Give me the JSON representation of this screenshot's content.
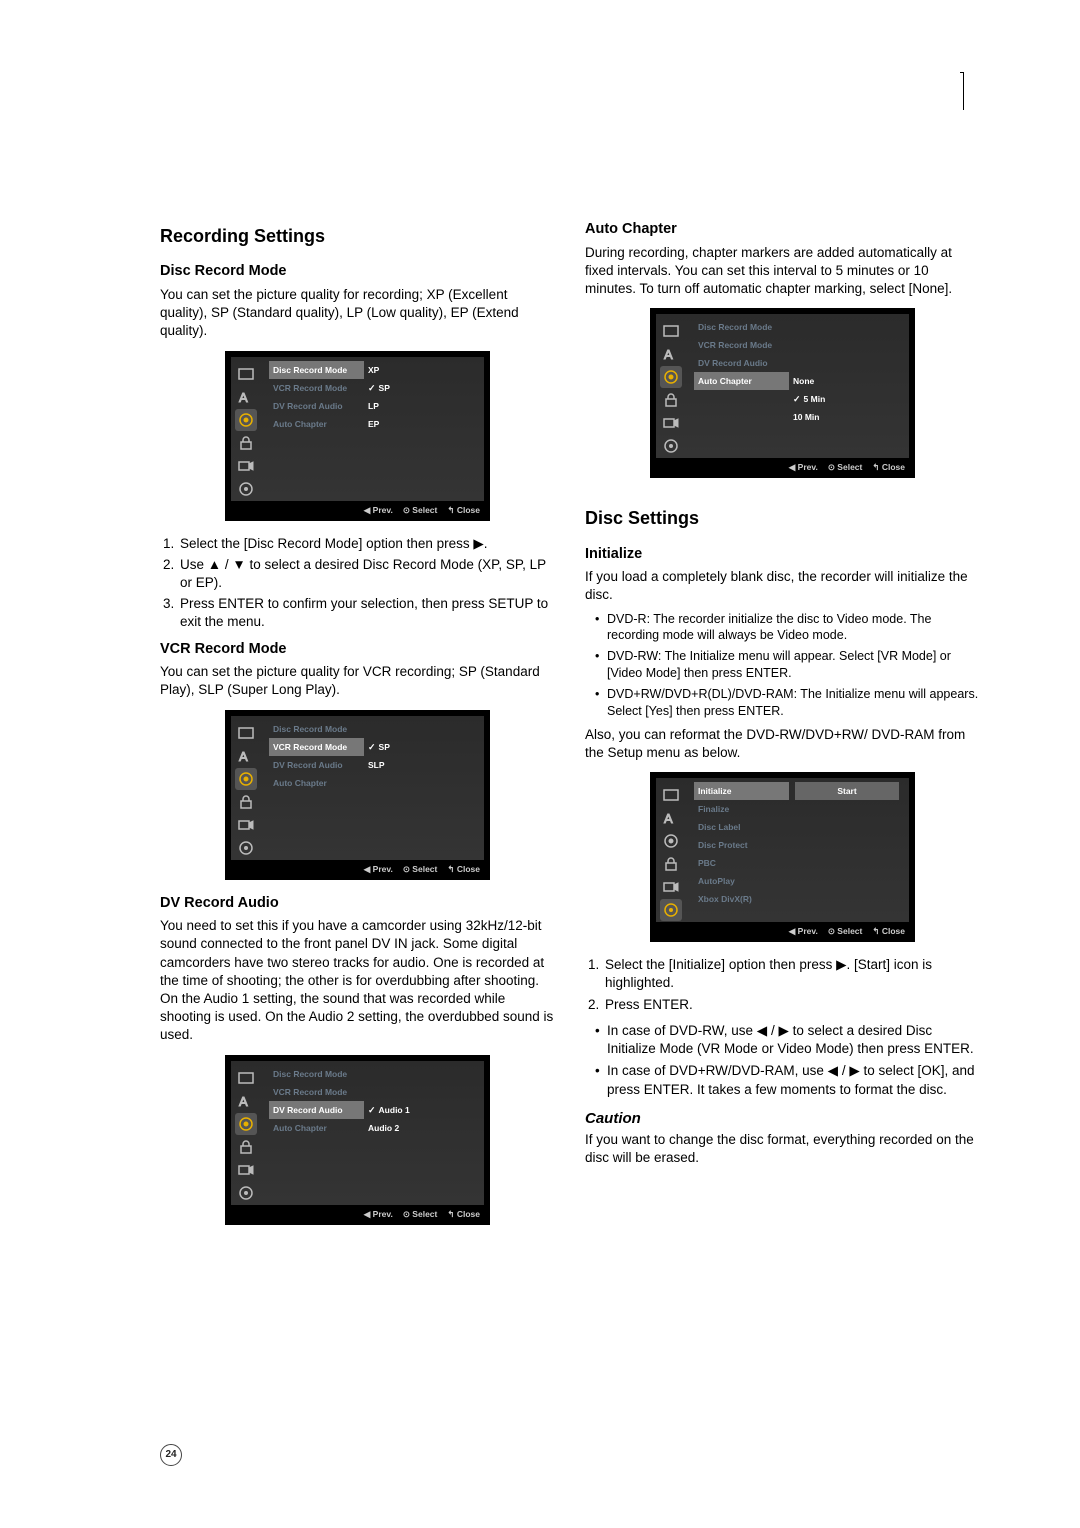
{
  "left": {
    "recordingSettings": "Recording Settings",
    "discRecordMode": {
      "title": "Disc Record Mode",
      "intro": "You can set the picture quality for recording; XP (Excellent quality), SP (Standard quality), LP (Low quality), EP (Extend quality).",
      "steps": [
        "Select the [Disc Record Mode] option then press ▶.",
        "Use ▲ / ▼ to select a desired Disc Record Mode (XP, SP, LP or EP).",
        "Press ENTER to confirm your selection, then press SETUP to exit the menu."
      ]
    },
    "vcrRecordMode": {
      "title": "VCR Record Mode",
      "intro": "You can set the picture quality for VCR recording; SP (Standard Play), SLP (Super Long Play)."
    },
    "dvRecordAudio": {
      "title": "DV Record Audio",
      "intro": "You need to set this if you have a camcorder using 32kHz/12-bit sound connected to the front panel DV IN jack. Some digital camcorders have two stereo tracks for audio. One is recorded at the time of shooting; the other is for overdubbing after shooting. On the Audio 1 setting, the sound that was recorded while shooting is used. On the Audio 2 setting, the overdubbed sound is used."
    }
  },
  "right": {
    "autoChapter": {
      "title": "Auto Chapter",
      "intro": "During recording, chapter markers are added automatically at fixed intervals. You can set this interval to 5 minutes or 10 minutes. To turn off automatic chapter marking, select [None]."
    },
    "discSettings": "Disc Settings",
    "initialize": {
      "title": "Initialize",
      "intro": "If you load a completely blank disc, the recorder will initialize the disc.",
      "bullets": [
        "DVD-R: The recorder initialize the disc to Video mode. The recording mode will always be Video mode.",
        "DVD-RW: The Initialize menu will appear. Select [VR Mode] or [Video Mode] then press ENTER.",
        "DVD+RW/DVD+R(DL)/DVD-RAM: The Initialize menu will appears. Select [Yes] then press ENTER."
      ],
      "also": "Also, you can reformat the DVD-RW/DVD+RW/ DVD-RAM from the Setup menu as below.",
      "steps": [
        "Select the [Initialize] option then press ▶. [Start] icon is highlighted.",
        "Press ENTER."
      ],
      "post": [
        "In case of DVD-RW, use ◀ / ▶ to select a desired Disc Initialize Mode (VR Mode or Video Mode) then press ENTER.",
        "In case of DVD+RW/DVD-RAM, use ◀ / ▶ to select [OK], and press ENTER. It takes a few moments to format the disc."
      ],
      "cautionTitle": "Caution",
      "caution": "If you want to change the disc format, everything recorded on the disc will be erased."
    }
  },
  "osd": {
    "prev": "◀ Prev.",
    "select": "⊙ Select",
    "close": "↰ Close",
    "items": {
      "disc": "Disc Record Mode",
      "vcr": "VCR Record Mode",
      "dv": "DV Record Audio",
      "auto": "Auto Chapter",
      "xp": "XP",
      "sp": "SP",
      "lp": "LP",
      "ep": "EP",
      "slp": "SLP",
      "a1": "Audio 1",
      "a2": "Audio 2",
      "none": "None",
      "m5": "5 Min",
      "m10": "10 Min",
      "init": "Initialize",
      "final": "Finalize",
      "label": "Disc Label",
      "protect": "Disc Protect",
      "pbc": "PBC",
      "autoplay": "AutoPlay",
      "xbox": "Xbox DivX(R)",
      "start": "Start"
    }
  },
  "pageNumber": "24"
}
